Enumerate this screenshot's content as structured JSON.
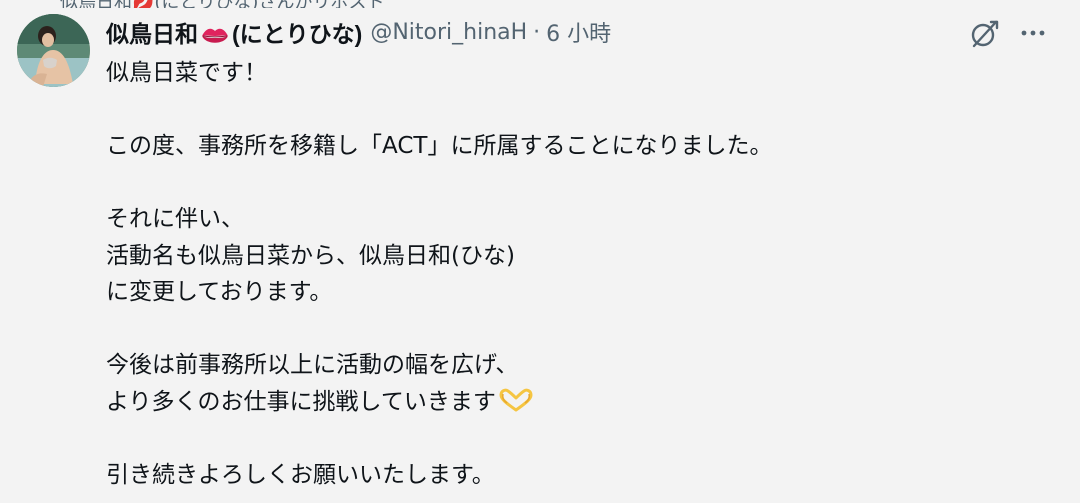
{
  "tweet": {
    "context_text": "似鳥日和💋(にとりひな)さんがリポスト",
    "display_name_before": "似鳥日和",
    "display_name_after": "(にとりひな)",
    "name_emoji": "kiss-lips-icon",
    "handle": "@Nitori_hinaH",
    "separator": "·",
    "time": "6 小時",
    "body_lines": [
      "似鳥日菜です！",
      "",
      "この度、事務所を移籍し「ACT」に所属することになりました。",
      "",
      "それに伴い、",
      "活動名も似鳥日菜から、似鳥日和(ひな)",
      "に変更しております。",
      "",
      "今後は前事務所以上に活動の幅を広げ、",
      "より多くのお仕事に挑戦していきます",
      "",
      "引き続きよろしくお願いいたします。"
    ],
    "inline_emoji": "heart-hands-icon"
  },
  "actions": {
    "grok_icon": "grok-icon",
    "more_icon": "more-dots-icon"
  },
  "colors": {
    "background": "#f3f3f3",
    "text": "#0f1419",
    "secondary": "#536471",
    "lips": "#e0245e",
    "heart_hands": "#f5c542"
  }
}
